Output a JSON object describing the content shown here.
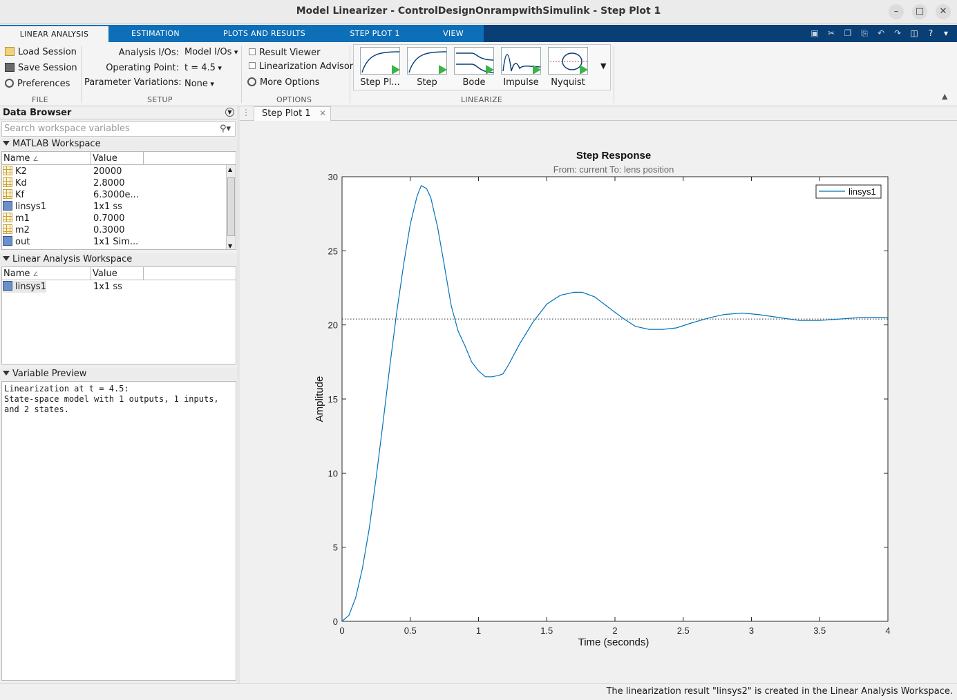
{
  "window": {
    "title": "Model Linearizer - ControlDesignOnrampwithSimulink - Step Plot 1"
  },
  "ribbon_tabs": [
    "LINEAR ANALYSIS",
    "ESTIMATION",
    "PLOTS AND RESULTS",
    "STEP PLOT 1",
    "VIEW"
  ],
  "file": {
    "load": "Load Session",
    "save": "Save Session",
    "prefs": "Preferences",
    "label": "FILE"
  },
  "setup": {
    "io_label": "Analysis I/Os:",
    "io_value": "Model I/Os",
    "op_label": "Operating Point:",
    "op_value": "t = 4.5",
    "pv_label": "Parameter Variations:",
    "pv_value": "None",
    "label": "SETUP"
  },
  "options": {
    "result_viewer": "Result Viewer",
    "lin_advisor": "Linearization Advisor",
    "more": "More Options",
    "label": "OPTIONS"
  },
  "linearize": {
    "label": "LINEARIZE",
    "gallery": [
      "Step Pl...",
      "Step",
      "Bode",
      "Impulse",
      "Nyquist"
    ]
  },
  "data_browser": {
    "title": "Data Browser",
    "search_placeholder": "Search workspace variables",
    "matlab_ws": {
      "title": "MATLAB Workspace",
      "col_name": "Name",
      "col_value": "Value",
      "rows": [
        {
          "name": "K2",
          "value": "20000",
          "kind": "matrix"
        },
        {
          "name": "Kd",
          "value": "2.8000",
          "kind": "matrix"
        },
        {
          "name": "Kf",
          "value": "6.3000e...",
          "kind": "matrix"
        },
        {
          "name": "linsys1",
          "value": "1x1 ss",
          "kind": "object"
        },
        {
          "name": "m1",
          "value": "0.7000",
          "kind": "matrix"
        },
        {
          "name": "m2",
          "value": "0.3000",
          "kind": "matrix"
        },
        {
          "name": "out",
          "value": "1x1 Sim...",
          "kind": "object"
        }
      ]
    },
    "linear_ws": {
      "title": "Linear Analysis Workspace",
      "col_name": "Name",
      "col_value": "Value",
      "rows": [
        {
          "name": "linsys1",
          "value": "1x1 ss",
          "kind": "object"
        }
      ]
    },
    "preview": {
      "title": "Variable Preview",
      "text": "Linearization at t = 4.5:\nState-space model with 1 outputs, 1 inputs,\nand 2 states."
    }
  },
  "doc_tab": {
    "label": "Step Plot 1"
  },
  "chart_data": {
    "type": "line",
    "title": "Step Response",
    "subtitle": "From: current  To: lens position",
    "xlabel": "Time (seconds)",
    "ylabel": "Amplitude",
    "xlim": [
      0,
      4
    ],
    "ylim": [
      0,
      30
    ],
    "xticks": [
      0,
      0.5,
      1,
      1.5,
      2,
      2.5,
      3,
      3.5,
      4
    ],
    "yticks": [
      0,
      5,
      10,
      15,
      20,
      25,
      30
    ],
    "steady_state": 20.4,
    "grid": false,
    "legend": "top-right",
    "series": [
      {
        "name": "linsys1",
        "color": "#0072bd",
        "x": [
          0,
          0.05,
          0.1,
          0.15,
          0.2,
          0.25,
          0.3,
          0.35,
          0.4,
          0.45,
          0.5,
          0.55,
          0.58,
          0.62,
          0.65,
          0.7,
          0.75,
          0.8,
          0.85,
          0.9,
          0.95,
          1.0,
          1.05,
          1.1,
          1.15,
          1.18,
          1.22,
          1.3,
          1.4,
          1.5,
          1.6,
          1.7,
          1.76,
          1.85,
          1.95,
          2.05,
          2.15,
          2.25,
          2.35,
          2.45,
          2.55,
          2.7,
          2.8,
          2.93,
          3.05,
          3.2,
          3.35,
          3.5,
          3.65,
          3.8,
          3.95,
          4.0
        ],
        "y": [
          0,
          0.4,
          1.6,
          3.6,
          6.3,
          9.7,
          13.4,
          17.2,
          20.8,
          24.0,
          26.8,
          28.7,
          29.4,
          29.2,
          28.6,
          26.6,
          24.0,
          21.3,
          19.6,
          18.6,
          17.5,
          16.9,
          16.5,
          16.5,
          16.6,
          16.7,
          17.3,
          18.7,
          20.2,
          21.4,
          22.0,
          22.2,
          22.2,
          21.9,
          21.2,
          20.5,
          19.9,
          19.7,
          19.7,
          19.8,
          20.1,
          20.5,
          20.7,
          20.8,
          20.7,
          20.5,
          20.3,
          20.3,
          20.4,
          20.5,
          20.5,
          20.5
        ]
      }
    ]
  },
  "status": {
    "text": "The linearization result \"linsys2\" is created in the Linear Analysis Workspace."
  }
}
